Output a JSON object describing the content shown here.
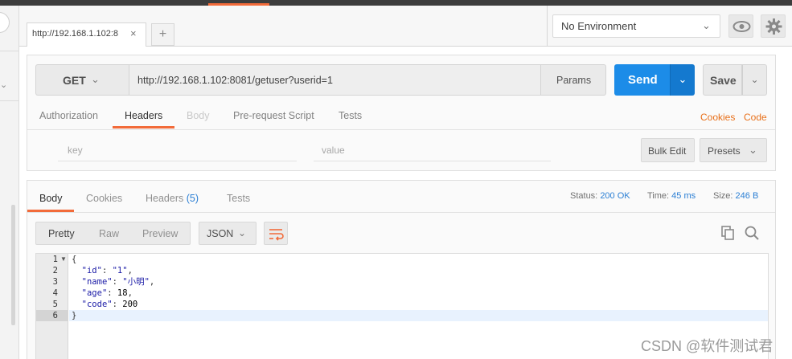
{
  "tabs": [
    {
      "label": "http://192.168.1.102:8",
      "close": "×"
    }
  ],
  "new_tab": "+",
  "environment": {
    "selected": "No Environment",
    "eye_icon": "eye-icon",
    "gear_icon": "gear-icon"
  },
  "request": {
    "method": "GET",
    "url": "http://192.168.1.102:8081/getuser?userid=1",
    "params_label": "Params",
    "send_label": "Send",
    "save_label": "Save",
    "tabs": [
      "Authorization",
      "Headers",
      "Body",
      "Pre-request Script",
      "Tests"
    ],
    "active_tab": "Headers",
    "cookies_link": "Cookies",
    "code_link": "Code",
    "headers_editor": {
      "key_placeholder": "key",
      "value_placeholder": "value",
      "bulk_edit_label": "Bulk Edit",
      "presets_label": "Presets"
    }
  },
  "response": {
    "tabs": {
      "body": "Body",
      "cookies": "Cookies",
      "headers": "Headers",
      "headers_count": "(5)",
      "tests": "Tests"
    },
    "active_tab": "Body",
    "status_label": "Status:",
    "status_value": "200 OK",
    "time_label": "Time:",
    "time_value": "45 ms",
    "size_label": "Size:",
    "size_value": "246 B",
    "format_modes": [
      "Pretty",
      "Raw",
      "Preview"
    ],
    "active_mode": "Pretty",
    "language": "JSON",
    "line_numbers": [
      "1",
      "2",
      "3",
      "4",
      "5",
      "6"
    ],
    "active_line": 6,
    "body": {
      "open": "{",
      "id_key": "\"id\"",
      "id_value": "\"1\"",
      "name_key": "\"name\"",
      "name_value": "\"小明\"",
      "age_key": "\"age\"",
      "age_value": "18",
      "code_key": "\"code\"",
      "code_value": "200",
      "close": "}"
    }
  },
  "watermark": "CSDN @软件测试君",
  "colors": {
    "accent": "#f26b3a",
    "send": "#1c8ce8",
    "link_orange": "#e8701a",
    "meta_blue": "#2b7fd4"
  }
}
